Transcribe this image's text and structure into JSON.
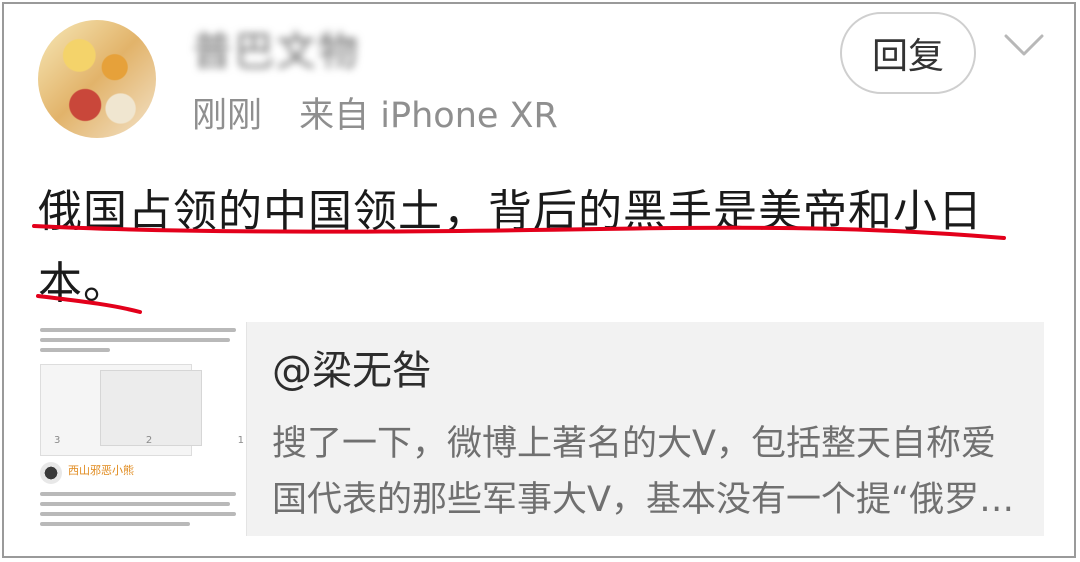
{
  "post": {
    "username": "普巴文物",
    "time": "刚刚",
    "source": "来自 iPhone XR",
    "reply_label": "回复",
    "text_line1": "俄国占领的中国领土，背后的黑手是美帝和小日",
    "text_line2": "本。"
  },
  "card": {
    "title": "@梁无咎",
    "desc_line1": "搜了一下，微博上著名的大V，包括整天自称爱",
    "desc_line2": "国代表的那些军事大V，基本没有一个提“俄罗…",
    "thumb_stats": [
      "3",
      "2",
      "1"
    ],
    "thumb_name": "西山邪恶小熊"
  },
  "icons": {
    "menu": "chevron-down-icon"
  },
  "colors": {
    "underline": "#e3001b",
    "text": "#1a1a1a",
    "meta": "#8f8f8f"
  }
}
